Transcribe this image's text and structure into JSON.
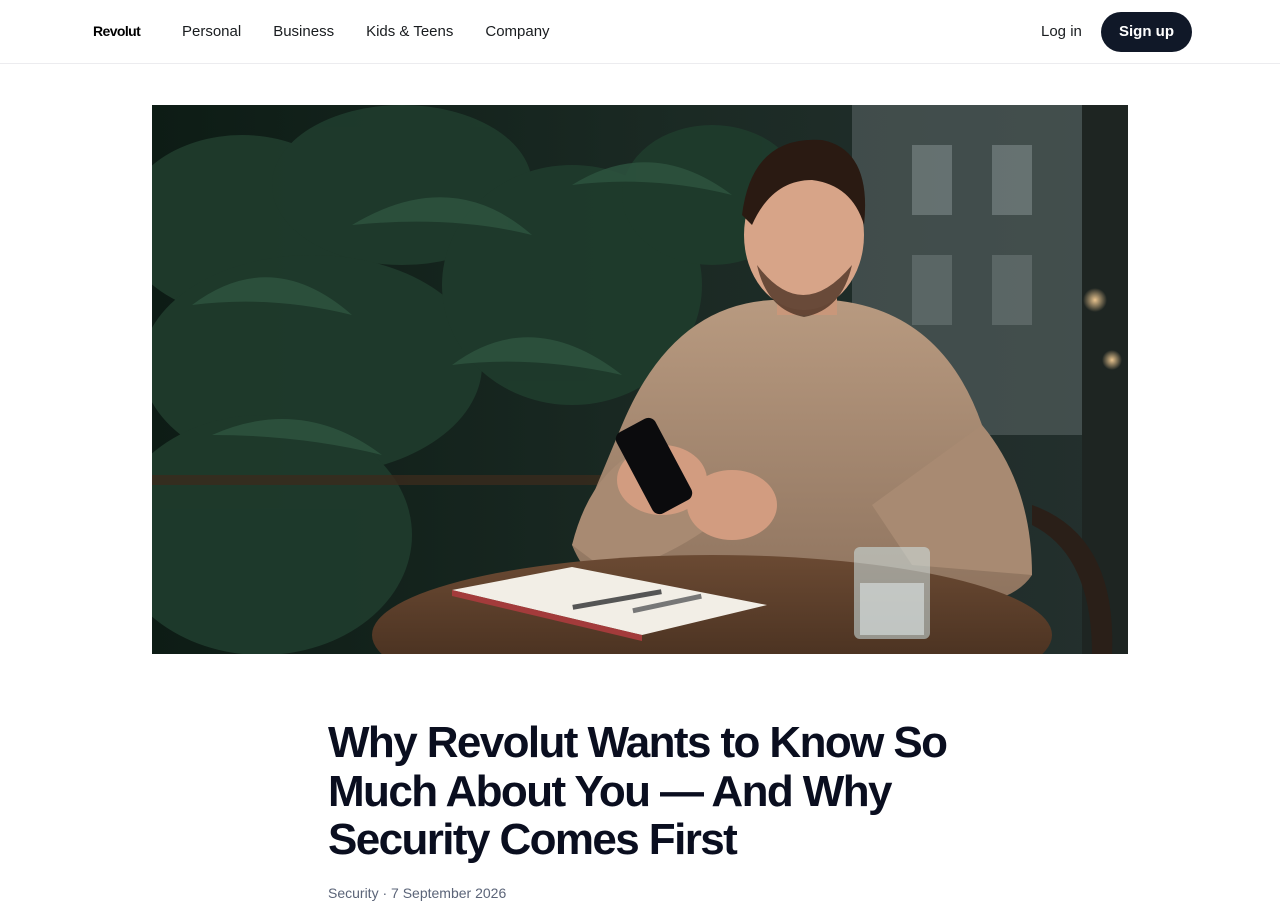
{
  "header": {
    "logo": "Revolut",
    "nav": [
      "Personal",
      "Business",
      "Kids & Teens",
      "Company"
    ],
    "login_label": "Log in",
    "signup_label": "Sign up",
    "signup_color": "#101828"
  },
  "hero": {
    "image": "man-using-phone-at-cafe-table-photo"
  },
  "article": {
    "title": "Why Revolut Wants to Know So Much About You — And Why Security Comes First",
    "category": "Security",
    "separator": " · ",
    "date": "7 September 2026"
  }
}
